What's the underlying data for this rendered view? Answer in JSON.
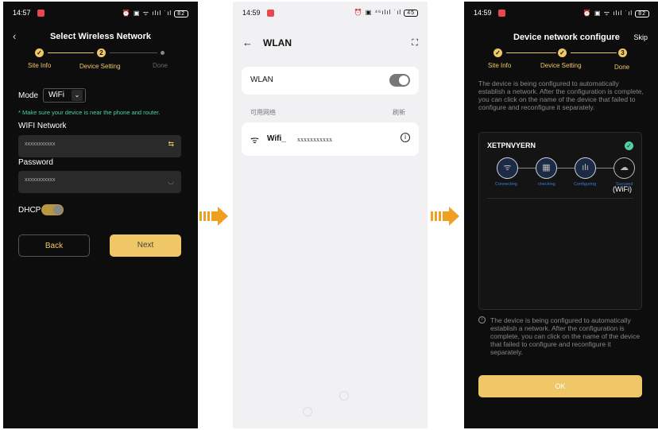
{
  "screen1": {
    "status_time": "14:57",
    "status_right": "⏰ ▣ ᯤ ılıl ˙ıl",
    "battery": "82",
    "title": "Select Wireless Network",
    "steps": [
      "Site Info",
      "Device Setting",
      "Done"
    ],
    "step2_num": "2",
    "mode_label": "Mode",
    "mode_value": "WiFi",
    "hint": "* Make sure your device is near the phone and router.",
    "wifi_label": "WIFI Network",
    "wifi_value": "xxxxxxxxxxx",
    "password_label": "Password",
    "password_value": "xxxxxxxxxxx",
    "dhcp_label": "DHCP",
    "back_label": "Back",
    "next_label": "Next"
  },
  "screen2": {
    "status_time": "14:59",
    "status_right": "⏰ ▣ ⁴⁶ılıl ˙ıl",
    "battery": "45",
    "title": "WLAN",
    "wlan_label": "WLAN",
    "available_label": "可用网络",
    "refresh_label": "刷新",
    "network_name": "Wifi_",
    "network_mask": "xxxxxxxxxxx"
  },
  "screen3": {
    "status_time": "14:59",
    "status_right": "⏰ ▣ ᯤ ılıl ˙ıl",
    "battery": "82",
    "title": "Device network configure",
    "skip_label": "Skip",
    "steps": [
      "Site Info",
      "Device Setting",
      "Done"
    ],
    "step3_num": "3",
    "intro": "The device is being configured to automatically establish a network. After the configuration is complete, you can click on the name of the device that failed to configure and reconfigure it separately.",
    "device_name": "XETPNVYERN",
    "progress_labels": [
      "Connecting",
      "checking",
      "Configuring",
      "Succeed"
    ],
    "wifi_tag": "(WiFi)",
    "note": "The device is being configured to automatically establish a network. After the configuration is complete, you can click on the name of the device that failed to configure and reconfigure it separately.",
    "ok_label": "OK"
  },
  "colors": {
    "accent": "#f0c766",
    "hint": "#4fd0a8",
    "arrow": "#f0a020"
  }
}
